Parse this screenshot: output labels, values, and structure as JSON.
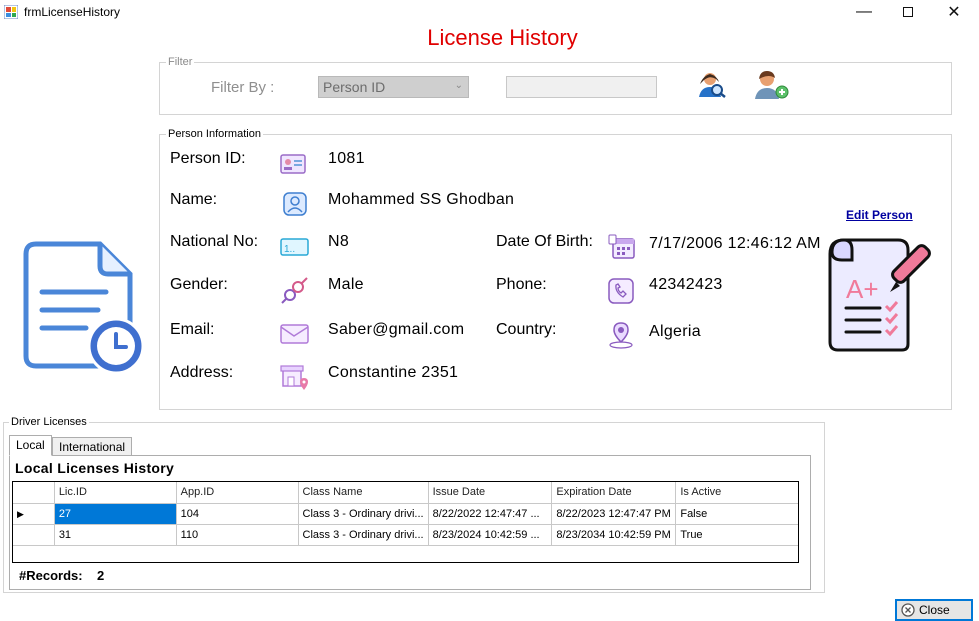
{
  "window": {
    "title": "frmLicenseHistory"
  },
  "heading": "License History",
  "filter": {
    "legend": "Filter",
    "filter_by_label": "Filter By :",
    "selected": "Person ID",
    "text_value": ""
  },
  "person": {
    "legend": "Person Information",
    "person_id_label": "Person ID:",
    "person_id": "1081",
    "name_label": "Name:",
    "name": "Mohammed SS  Ghodban",
    "national_no_label": "National No:",
    "national_no": "N8",
    "dob_label": "Date Of Birth:",
    "dob": "7/17/2006 12:46:12 AM",
    "gender_label": "Gender:",
    "gender": "Male",
    "phone_label": "Phone:",
    "phone": "42342423",
    "email_label": "Email:",
    "email": "Saber@gmail.com",
    "country_label": "Country:",
    "country": "Algeria",
    "address_label": "Address:",
    "address": "Constantine 2351",
    "edit_link": "Edit Person "
  },
  "licenses": {
    "legend": "Driver Licenses",
    "tabs": [
      "Local",
      "International"
    ],
    "section_title": "Local Licenses History",
    "columns": [
      "Lic.ID",
      "App.ID",
      "Class Name",
      "Issue Date",
      "Expiration Date",
      "Is Active"
    ],
    "rows": [
      [
        "27",
        "104",
        "Class 3 - Ordinary drivi...",
        "8/22/2022 12:47:47 ...",
        "8/22/2023 12:47:47 PM",
        "False"
      ],
      [
        "31",
        "110",
        "Class 3 - Ordinary drivi...",
        "8/23/2024 10:42:59 ...",
        "8/23/2034 10:42:59 PM",
        "True"
      ]
    ],
    "records_label": "#Records:",
    "records_count": "2"
  },
  "close_label": "Close",
  "colors": {
    "heading": "#e00000",
    "selection": "#0078d7",
    "link": "#0000a0"
  }
}
